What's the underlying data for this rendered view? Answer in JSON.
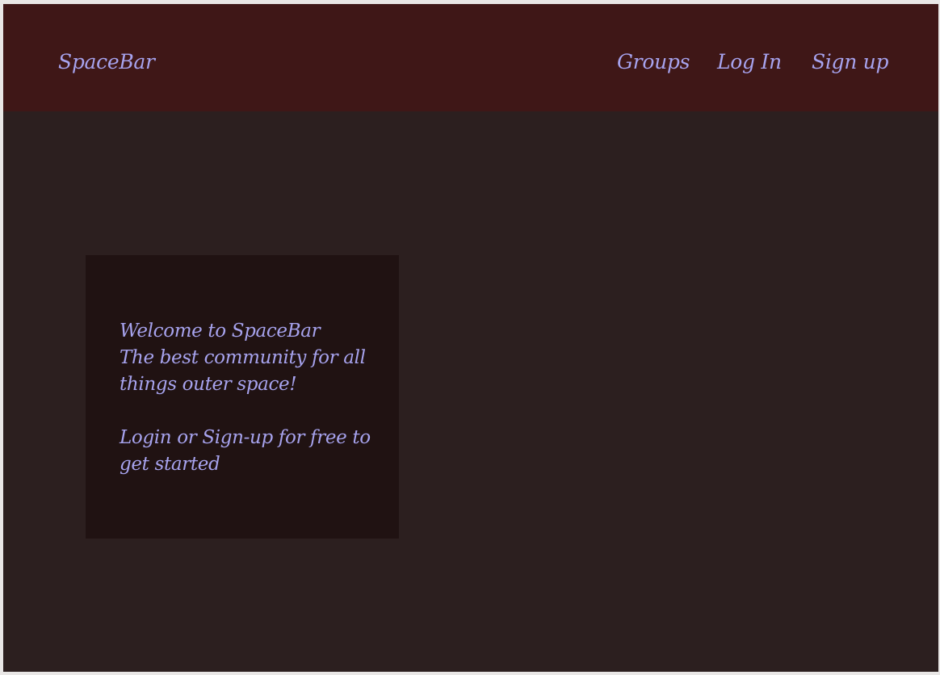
{
  "header": {
    "brand": "SpaceBar",
    "nav": {
      "groups": "Groups",
      "login": "Log In",
      "signup": "Sign up"
    }
  },
  "welcome": {
    "title": "Welcome to SpaceBar",
    "subtitle": "The best community for all things outer space!",
    "cta": "Login or Sign-up for free to get started"
  },
  "colors": {
    "background": "#2c1f1f",
    "navbar": "#3f1717",
    "card": "#201212",
    "text": "#a7a3ee"
  }
}
